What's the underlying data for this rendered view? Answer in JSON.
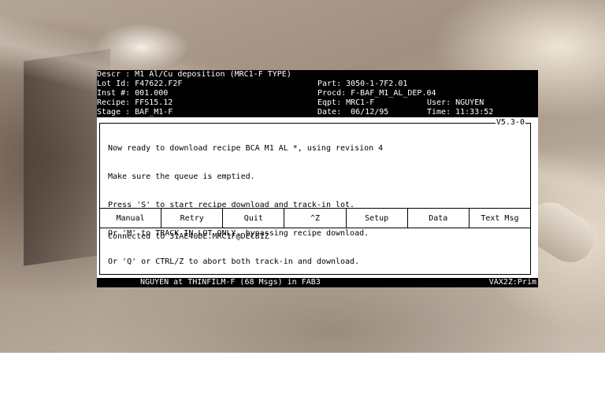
{
  "header": {
    "descr": "Descr : M1 Al/Cu deposition (MRC1-F TYPE)",
    "lot": "Lot Id: F47622.F2F",
    "part": "Part: 3050-1-7F2.01",
    "inst": "Inst #: 001.000",
    "procd": "Procd: F-BAF_M1_AL_DEP.04",
    "recipe": "Recipe: FFS15.12",
    "eqpt": "Eqpt: MRC1-F",
    "user": "User: NGUYEN",
    "stage": "Stage : BAF_M1-F",
    "date": "Date:  06/12/95",
    "time": "Time: 11:33:52"
  },
  "panel": {
    "version": "V5.3-0",
    "message_lines": [
      "Now ready to download recipe BCA M1 AL *, using revision 4",
      "Make sure the queue is emptied.",
      "Press 'S' to start recipe download and track-in lot.",
      "Or 'M' to TRACK IN LOT ONLY, bypassing recipe download.",
      "Or 'Q' or CTRL/Z to abort both track-in and download."
    ],
    "buttons": [
      "Manual",
      "Retry",
      "Quit",
      "^Z",
      "Setup",
      "Data",
      "Text Msg"
    ],
    "connection": "Connected to 31AE40DE.MRC1F@DEC81Z"
  },
  "status": {
    "left": "NGUYEN at THINFILM-F (68 Msgs) in FAB3",
    "right": "VAX2Z:Prim"
  }
}
